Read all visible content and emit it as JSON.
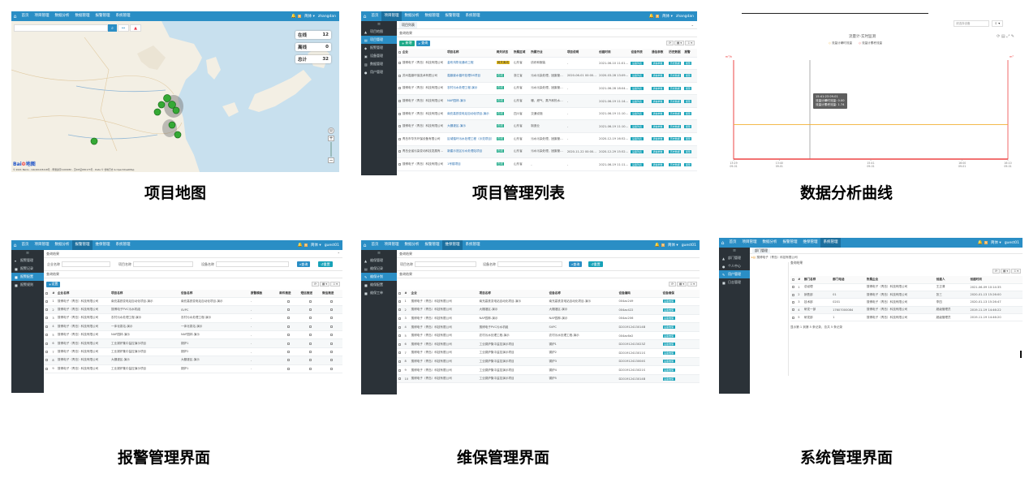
{
  "captions": {
    "map": "项目地图",
    "project_list": "项目管理列表",
    "curve": "数据分析曲线",
    "alarm": "报警管理界面",
    "maintenance": "维保管理界面",
    "system": "系统管理界面"
  },
  "top_nav": {
    "items_a": [
      "首页",
      "项目管理",
      "数据分析",
      "数据管理",
      "报警管理",
      "系统管理"
    ],
    "items_b": [
      "首页",
      "项目管理",
      "数据分析",
      "报警管理",
      "维保管理",
      "系统管理"
    ],
    "username_a": "zhangdan",
    "username_b": "guest01",
    "lang": "简体 ▾",
    "badge": "9"
  },
  "map_panel": {
    "stats": [
      {
        "label": "在线",
        "value": "12"
      },
      {
        "label": "离线",
        "value": "0"
      },
      {
        "label": "总计",
        "value": "32"
      }
    ],
    "search_placeholder": "",
    "logo": "Bai",
    "logo_tail": "地图",
    "copyright": "© 2021 Baidu - GS(2019)5218号 - 甲测资字1100930 - 京ICP证030173号 - Data © 长地万方 & OpenStreetMap"
  },
  "list_panel": {
    "crumb_tab": "项目列表",
    "section": "查询结果",
    "add_label": "新增",
    "query_label": "查询",
    "sidebar": [
      "项目地图",
      "项目管理",
      "报警管理",
      "设备管理",
      "数据管理",
      "用户管理"
    ],
    "headers": [
      "企业",
      "项目名称",
      "网关状态",
      "所属区域",
      "所属行业",
      "项目说明",
      "创建时间",
      "设备列表",
      "通信参数",
      "历史数据",
      "报警"
    ],
    "rows": [
      [
        "搜博电子（青岛）科技有限公司",
        "金布鸿彰化通讯工程",
        "网关离线",
        "山东省",
        "纺织和服装",
        "-",
        "2021-06-10 11:01:23"
      ],
      [
        "苏州嘉鼎环保技术有限公司",
        "嘉鼎废水循环处理DS项目",
        "在线",
        "浙江省",
        "污水污染处理、固废管理和水处理业",
        "2020-06-01 00:00:00",
        "2020-03-28 13:09:59"
      ],
      [
        "搜博电子（青岛）科技有限公司",
        "农村污水处理工程-演示",
        "在线",
        "山东省",
        "污水污染处理、固废管理和水处理业",
        "-",
        "2021-06-28 18:04:29"
      ],
      [
        "搜博电子（青岛）科技有限公司",
        "NAP园林-演示",
        "在线",
        "山东省",
        "暖、燃气、蒸汽和热水供应",
        "-",
        "2021-06-19 11:14:36"
      ],
      [
        "搜博电子（青岛）科技有限公司",
        "南充高铁变电站自动化项目-演示",
        "在线",
        "四川省",
        "交通设施",
        "-",
        "2021-06-19 11:10:30"
      ],
      [
        "搜博电子（青岛）科技有限公司",
        "大棚灌区-演示",
        "在线",
        "山东省",
        "制造业",
        "-",
        "2021-06-19 11:10:49"
      ],
      [
        "青岛市华东环保设备有限公司",
        "区域循环污水处理工程（示范项目）",
        "在线",
        "山东省",
        "污水污染处理、固废管理和水处理业",
        "-",
        "2020-12-19 16:52:47"
      ],
      [
        "青岛全省污染变动科技发展有限公司",
        "新建示范区污水处理站项目",
        "在线",
        "山东省",
        "污水污染处理、固废管理和水处理业",
        "2020-11-22 00:00:00",
        "2020-12-29 15:52:59"
      ],
      [
        "搜博电子（青岛）科技有限公司",
        "1号楼项目",
        "在线",
        "山东省",
        "-",
        "-",
        "2021-06-19 11:11:00"
      ]
    ],
    "op_labels": [
      "设备列表",
      "通信参数",
      "历史数据",
      "报警"
    ]
  },
  "curve_panel": {
    "search_placeholder": "请选择设备",
    "chart_title": "流量计-实时监测",
    "legend": [
      "流量计瞬时流量",
      "流量计累积流量"
    ],
    "tooltip": [
      "15:41:23 09-01",
      "流量计瞬时流量: 0.00",
      "流量计累积流量: 1.74"
    ],
    "y_left_unit": "m³/h",
    "y_right_unit": "m³",
    "colors": {
      "series1": "#f2b035",
      "series2": "#ee4444",
      "axis": "#ee4444"
    },
    "chart_data": {
      "type": "line",
      "x": [
        "13:29 09-01",
        "13:40 09-01",
        "14:00 09-01",
        "15:41 09-01",
        "15:50 09-01",
        "16:00 09-01",
        "16:10 09-01"
      ],
      "series": [
        {
          "name": "流量计瞬时流量",
          "values": [
            0,
            0,
            0,
            0,
            0,
            0,
            0
          ]
        },
        {
          "name": "流量计累积流量",
          "values": [
            1.74,
            1.74,
            1.74,
            1.74,
            1.74,
            1.74,
            1.74
          ]
        }
      ],
      "xticks": [
        "13:29 09-01",
        "13:40 09-01",
        "15:41 09-01",
        "16:00 09-01",
        "16:10 09-01"
      ]
    }
  },
  "alarm_panel": {
    "sidebar": [
      "报警管理",
      "报警记录",
      "报警配置",
      "报警规则"
    ],
    "filters": [
      "企业名称",
      "项目名称",
      "设备名称"
    ],
    "query_label": "查询",
    "reset_label": "重置",
    "section": "查询结果",
    "add_label": "设置",
    "headers": [
      "#",
      "企业名称",
      "项目名称",
      "设备名称",
      "报警模板",
      "邮件推送",
      "短信推送",
      "微信推送"
    ],
    "rows": [
      [
        "1",
        "搜博电子（青岛）科技有限公司",
        "南充高铁变电站自动化项目-演示",
        "南充高铁变电站自动化项目-演示",
        "-"
      ],
      [
        "2",
        "搜博电子（青岛）科技有限公司",
        "搜博电子PVC污水机组",
        "SVPC",
        "-"
      ],
      [
        "3",
        "搜博电子（青岛）科技有限公司",
        "农村污水处理工程-演示",
        "农村污水处理工程-演示",
        "-"
      ],
      [
        "4",
        "搜博电子（青岛）科技有限公司",
        "一体化泵站-演示",
        "一体化泵站-演示",
        "-"
      ],
      [
        "5",
        "搜博电子（青岛）科技有限公司",
        "NAP园林-演示",
        "NAP园林-演示",
        "-"
      ],
      [
        "6",
        "搜博电子（青岛）科技有限公司",
        "工业锅炉集中监控演示项目",
        "锅炉1",
        "-"
      ],
      [
        "7",
        "搜博电子（青岛）科技有限公司",
        "工业锅炉集中监控演示项目",
        "锅炉2",
        "-"
      ],
      [
        "8",
        "搜博电子（青岛）科技有限公司",
        "大棚灌区-演示",
        "大棚灌区-演示",
        "-"
      ],
      [
        "9",
        "搜博电子（青岛）科技有限公司",
        "工业锅炉集中监控演示项目",
        "锅炉1",
        "-"
      ]
    ]
  },
  "maint_panel": {
    "sidebar": [
      "维保管理",
      "维保记录",
      "维保计划",
      "维保配置",
      "维保工单"
    ],
    "filters": [
      "项目名称",
      "设备名称"
    ],
    "query_label": "查询",
    "reset_label": "重置",
    "section": "查询结果",
    "headers": [
      "#",
      "企业",
      "项目名称",
      "设备名称",
      "设备编码",
      "设备维保"
    ],
    "op_label": "设备维保",
    "rows": [
      [
        "1",
        "搜博电子（青岛）科技有限公司",
        "南充高铁变电站自动化项目-演示",
        "南充高铁变电站自动化项目-演示",
        "004ac249"
      ],
      [
        "2",
        "搜博电子（青岛）科技有限公司",
        "大棚灌区-演示",
        "大棚灌区-演示",
        "004ac422"
      ],
      [
        "3",
        "搜博电子（青岛）科技有限公司",
        "NAP园林-演示",
        "NAP园林-演示",
        "004ac206"
      ],
      [
        "4",
        "搜博电子（青岛）科技有限公司",
        "搜博电子PVC污水机组",
        "SVPC",
        "D201912413014B"
      ],
      [
        "5",
        "搜博电子（青岛）科技有限公司",
        "农村污水处理工程-演示",
        "农村污水处理工程-演示",
        "004ac6e2"
      ],
      [
        "6",
        "搜博电子（青岛）科技有限公司",
        "工业锅炉集中监控演示项目",
        "锅炉1",
        "D201912413023Z"
      ],
      [
        "7",
        "搜博电子（青岛）科技有限公司",
        "工业锅炉集中监控演示项目",
        "锅炉2",
        "D201912413011S"
      ],
      [
        "8",
        "搜博电子（青岛）科技有限公司",
        "工业锅炉集中监控演示项目",
        "锅炉3",
        "D201912413004S"
      ],
      [
        "9",
        "搜博电子（青岛）科技有限公司",
        "工业锅炉集中监控演示项目",
        "锅炉4",
        "D201912413021S"
      ],
      [
        "10",
        "搜博电子（青岛）科技有限公司",
        "工业锅炉集中监控演示项目",
        "锅炉5",
        "D201912413014B"
      ]
    ]
  },
  "system_panel": {
    "sidebar": [
      "部门管理",
      "个人中心",
      "用户管理",
      "日志管理"
    ],
    "crumb_tab": "部门管理",
    "crumb_path": "搜博电子（青岛）科技有限公司",
    "section": "查询结果",
    "headers": [
      "#",
      "部门名称",
      "部门电话",
      "所属企业",
      "创建人",
      "创建时间"
    ],
    "rows": [
      [
        "1",
        "总经理",
        "",
        "搜博电子（青岛）科技有限公司",
        "王正清",
        "2021-06-09 10:14:35"
      ],
      [
        "2",
        "销售部",
        "01",
        "搜博电子（青岛）科技有限公司",
        "张三",
        "2020-01-13 15:26:00"
      ],
      [
        "3",
        "技术部",
        "0201",
        "搜博电子（青岛）科技有限公司",
        "李四",
        "2020-01-13 15:26:47"
      ],
      [
        "4",
        "研发一部",
        "17607000084",
        "搜博电子（青岛）科技有限公司",
        "超级管理员",
        "2019-11-19 14:46:22"
      ],
      [
        "5",
        "研发部",
        "1",
        "搜博电子（青岛）科技有限公司",
        "超级管理员",
        "2019-11-19 14:46:20"
      ]
    ],
    "footer": "显示第 1 到第 5 条记录，总共 5 条记录"
  }
}
